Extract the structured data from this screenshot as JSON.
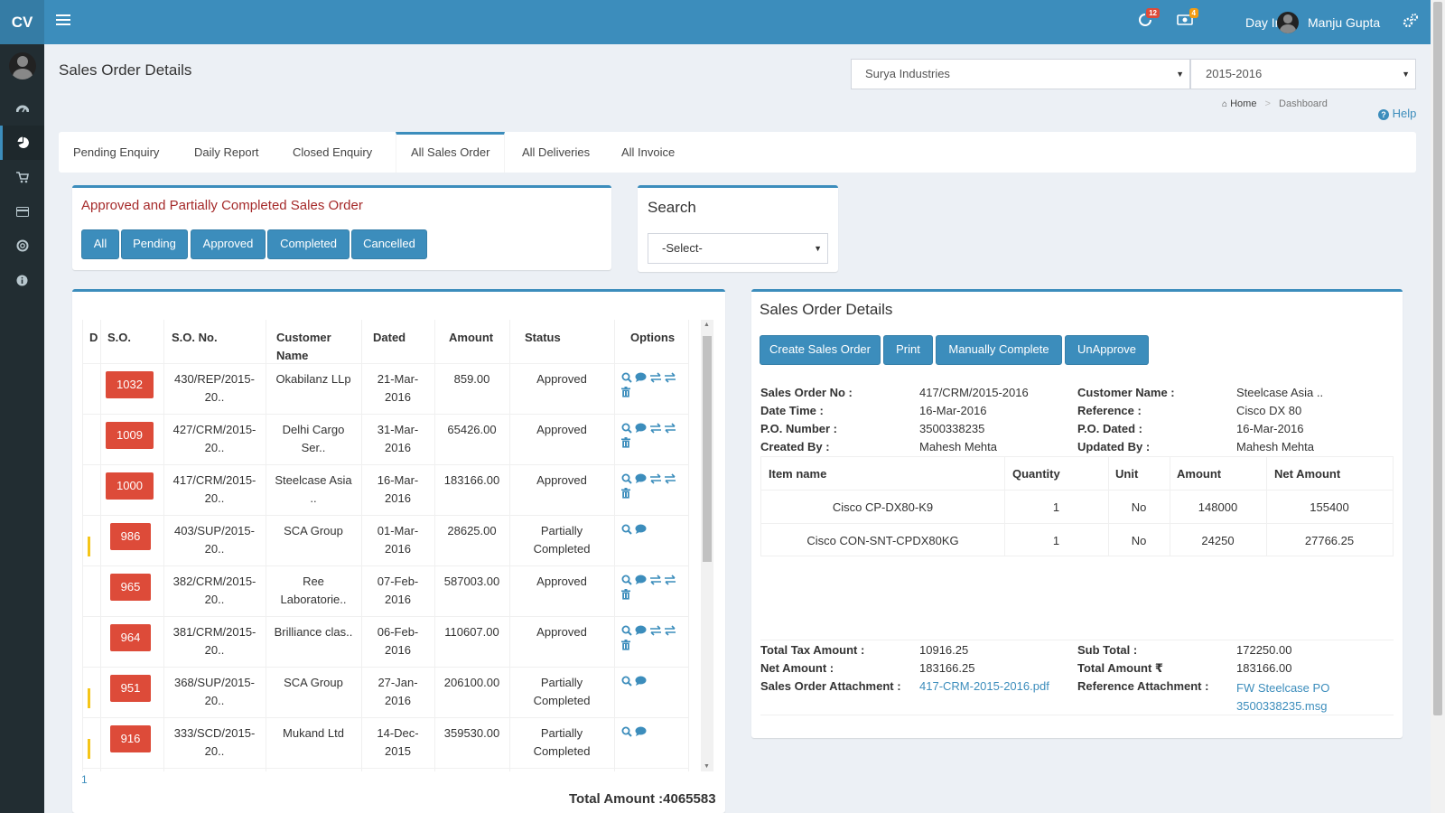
{
  "header": {
    "logo": "CV",
    "notif_count": "12",
    "cash_count": "4",
    "day_in": "Day In",
    "user": "Manju Gupta"
  },
  "page": {
    "title": "Sales Order Details",
    "company": "Surya Industries",
    "year": "2015-2016",
    "breadcrumb": {
      "home": "Home",
      "sep": ">",
      "current": "Dashboard"
    },
    "help": "Help"
  },
  "tabs": [
    "Pending Enquiry",
    "Daily Report",
    "Closed Enquiry",
    "All Sales Order",
    "All Deliveries",
    "All Invoice"
  ],
  "filter": {
    "title": "Approved and Partially Completed Sales Order",
    "buttons": [
      "All",
      "Pending",
      "Approved",
      "Completed",
      "Cancelled"
    ]
  },
  "search": {
    "title": "Search",
    "select": "-Select-"
  },
  "orders": {
    "headers": [
      "D",
      "S.O.",
      "S.O. No.",
      "Customer Name",
      "Dated",
      "Amount",
      "Status",
      "Options"
    ],
    "rows": [
      {
        "so": "1032",
        "so_no": "430/REP/2015-20..",
        "customer": "Okabilanz LLp",
        "dated": "21-Mar-2016",
        "amount": "859.00",
        "status": "Approved",
        "flag": false
      },
      {
        "so": "1009",
        "so_no": "427/CRM/2015-20..",
        "customer": "Delhi Cargo Ser..",
        "dated": "31-Mar-2016",
        "amount": "65426.00",
        "status": "Approved",
        "flag": false
      },
      {
        "so": "1000",
        "so_no": "417/CRM/2015-20..",
        "customer": "Steelcase Asia ..",
        "dated": "16-Mar-2016",
        "amount": "183166.00",
        "status": "Approved",
        "flag": false
      },
      {
        "so": "986",
        "so_no": "403/SUP/2015-20..",
        "customer": "SCA Group",
        "dated": "01-Mar-2016",
        "amount": "28625.00",
        "status": "Partially Completed",
        "flag": true
      },
      {
        "so": "965",
        "so_no": "382/CRM/2015-20..",
        "customer": "Ree Laboratorie..",
        "dated": "07-Feb-2016",
        "amount": "587003.00",
        "status": "Approved",
        "flag": false
      },
      {
        "so": "964",
        "so_no": "381/CRM/2015-20..",
        "customer": "Brilliance clas..",
        "dated": "06-Feb-2016",
        "amount": "110607.00",
        "status": "Approved",
        "flag": false
      },
      {
        "so": "951",
        "so_no": "368/SUP/2015-20..",
        "customer": "SCA Group",
        "dated": "27-Jan-2016",
        "amount": "206100.00",
        "status": "Partially Completed",
        "flag": true
      },
      {
        "so": "916",
        "so_no": "333/SCD/2015-20..",
        "customer": "Mukand Ltd",
        "dated": "14-Dec-2015",
        "amount": "359530.00",
        "status": "Partially Completed",
        "flag": true
      }
    ],
    "page_number": "1",
    "total": "Total Amount :4065583"
  },
  "details": {
    "title": "Sales Order Details",
    "buttons": [
      "Create Sales Order",
      "Print",
      "Manually Complete",
      "UnApprove"
    ],
    "fields_left": [
      {
        "label": "Sales Order No :",
        "value": "417/CRM/2015-2016"
      },
      {
        "label": "Date Time :",
        "value": "16-Mar-2016"
      },
      {
        "label": "P.O. Number :",
        "value": "3500338235"
      },
      {
        "label": "Created By :",
        "value": "Mahesh Mehta"
      }
    ],
    "fields_right": [
      {
        "label": "Customer Name :",
        "value": "Steelcase Asia .."
      },
      {
        "label": "Reference :",
        "value": "Cisco DX 80"
      },
      {
        "label": "P.O. Dated :",
        "value": "16-Mar-2016"
      },
      {
        "label": "Updated By :",
        "value": "Mahesh Mehta"
      }
    ],
    "item_headers": [
      "Item name",
      "Quantity",
      "Unit",
      "Amount",
      "Net Amount"
    ],
    "items": [
      {
        "name": "Cisco CP-DX80-K9",
        "qty": "1",
        "unit": "No",
        "amount": "148000",
        "net": "155400"
      },
      {
        "name": "Cisco CON-SNT-CPDX80KG",
        "qty": "1",
        "unit": "No",
        "amount": "24250",
        "net": "27766.25"
      }
    ],
    "totals": {
      "tax_label": "Total Tax Amount :",
      "tax": "10916.25",
      "net_label": "Net Amount :",
      "net": "183166.25",
      "attach_label": "Sales Order Attachment :",
      "attach": "417-CRM-2015-2016.pdf",
      "sub_label": "Sub Total :",
      "sub": "172250.00",
      "total_label": "Total Amount ₹",
      "total": "183166.00",
      "ref_label": "Reference Attachment :",
      "ref_line1": "FW Steelcase PO",
      "ref_line2": "3500338235.msg"
    }
  }
}
